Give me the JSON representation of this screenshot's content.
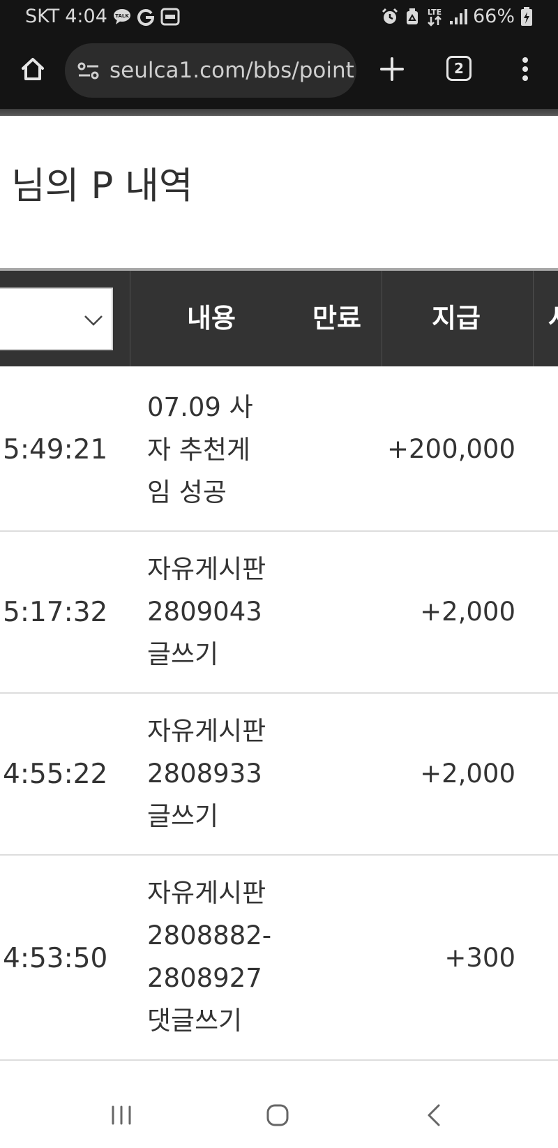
{
  "status_bar": {
    "carrier": "SKT",
    "time": "4:04",
    "network": "LTE",
    "battery": "66%",
    "icons_left": [
      "talk-icon",
      "google-icon",
      "app-icon"
    ],
    "icons_right": [
      "alarm-icon",
      "recycle-icon",
      "lte-arrows-icon",
      "signal-icon",
      "battery-charging-icon"
    ]
  },
  "browser": {
    "url": "seulca1.com/bbs/point",
    "tab_count": "2"
  },
  "page": {
    "title": "님의 P 내역"
  },
  "table": {
    "headers": {
      "content": "내용",
      "expiry": "만료",
      "payment": "지급",
      "partial": "사"
    },
    "rows": [
      {
        "time": "5:49:21",
        "desc": "07.09 사\n자 추천게\n임 성공",
        "amount": "+200,000"
      },
      {
        "time": "5:17:32",
        "desc": "자유게시판\n2809043\n글쓰기",
        "amount": "+2,000"
      },
      {
        "time": "4:55:22",
        "desc": "자유게시판\n2808933\n글쓰기",
        "amount": "+2,000"
      },
      {
        "time": "4:53:50",
        "desc": "자유게시판\n2808882-\n2808927\n댓글쓰기",
        "amount": "+300"
      }
    ]
  },
  "nav_bar": {
    "icons": [
      "recent-apps-icon",
      "home-circle-icon",
      "back-icon"
    ]
  }
}
